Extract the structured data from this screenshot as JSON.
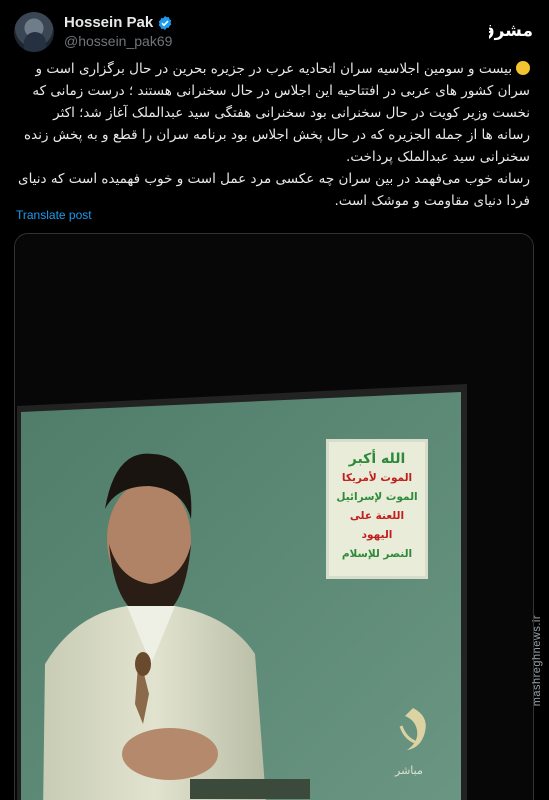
{
  "user": {
    "display_name": "Hossein Pak",
    "handle": "@hossein_pak69",
    "verified": true,
    "verified_color": "#1d9bf0"
  },
  "site_logo": {
    "text": "مشرق",
    "icon": "mashregh-logo-icon"
  },
  "tweet": {
    "paragraph_1": "بیست و سومین اجلاسیه سران اتحادیه عرب در جزیره بحرین در حال برگزاری است و سران کشور های عربی در افتتاحیه این اجلاس در حال سخنرانی هستند ؛ درست زمانی که نخست وزیر کویت در حال سخنرانی بود سخنرانی هفتگی سید عبدالملک آغاز شد؛ اکثر رسانه ها از جمله الجزیره که در حال پخش اجلاس بود برنامه سران را قطع و به پخش زنده سخنرانی سید عبدالملک پرداخت.",
    "paragraph_2": "رسانه خوب می‌فهمد در بین سران چه عکسی مرد عمل است و خوب فهمیده است که دنیای فردا دنیای مقاومت و موشک است.",
    "emoji": "yellow-circle-icon"
  },
  "translate_label": "Translate post",
  "media": {
    "banner_lines": [
      "الله أكبر",
      "الموت لأمريكا",
      "الموت لإسرائيل",
      "اللعنة على اليهود",
      "النصر للإسلام"
    ],
    "channel_label": "مباشر",
    "channel_logo": "aljazeera-logo-icon"
  },
  "watermark": "mashreghnews.ir",
  "colors": {
    "background": "#000000",
    "text": "#e7e9ea",
    "muted": "#71767b",
    "link": "#1d9bf0",
    "screen_green": "#5d8a76"
  }
}
